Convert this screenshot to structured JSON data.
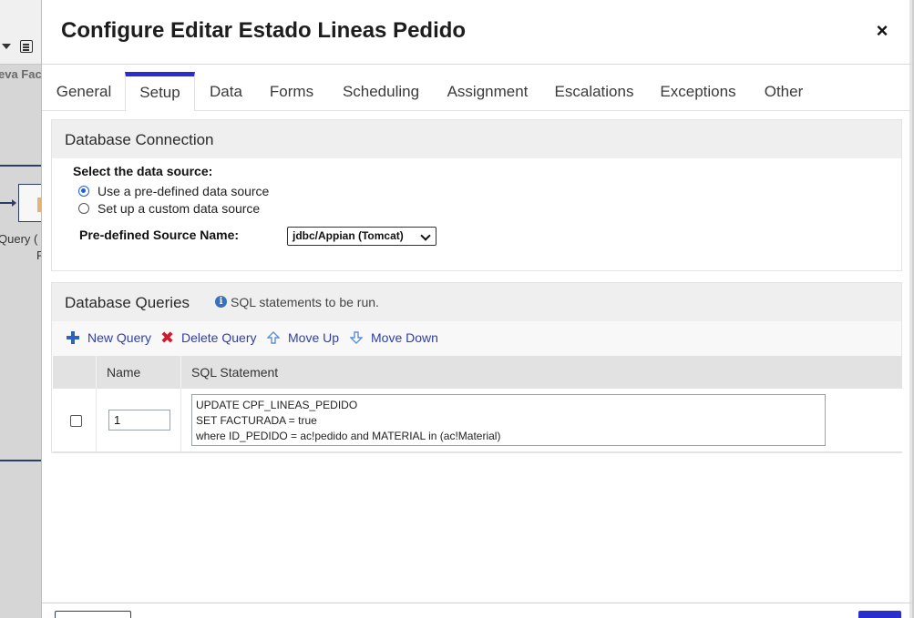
{
  "background_app": {
    "visible_text": "eva Fac",
    "node_label_line1": "Query  (",
    "node_label_line2": "F"
  },
  "dialog": {
    "title": "Configure Editar Estado Lineas Pedido",
    "close_icon": "×"
  },
  "tabs": [
    {
      "label": "General",
      "active": false
    },
    {
      "label": "Setup",
      "active": true
    },
    {
      "label": "Data",
      "active": false
    },
    {
      "label": "Forms",
      "active": false
    },
    {
      "label": "Scheduling",
      "active": false
    },
    {
      "label": "Assignment",
      "active": false
    },
    {
      "label": "Escalations",
      "active": false
    },
    {
      "label": "Exceptions",
      "active": false
    },
    {
      "label": "Other",
      "active": false
    }
  ],
  "database_connection": {
    "title": "Database Connection",
    "source_label": "Select the data source:",
    "options": [
      {
        "label": "Use a pre-defined data source",
        "selected": true
      },
      {
        "label": "Set up a custom data source",
        "selected": false
      }
    ],
    "predefined_label": "Pre-defined Source Name:",
    "predefined_value": "jdbc/Appian (Tomcat)"
  },
  "database_queries": {
    "title": "Database Queries",
    "info_text": "SQL statements to be run.",
    "toolbar": {
      "new_query": "New Query",
      "delete_query": "Delete Query",
      "move_up": "Move Up",
      "move_down": "Move Down"
    },
    "columns": {
      "name": "Name",
      "sql": "SQL Statement"
    },
    "rows": [
      {
        "checked": false,
        "name": "1",
        "sql": "UPDATE CPF_LINEAS_PEDIDO\nSET FACTURADA = true\nwhere ID_PEDIDO = ac!pedido and MATERIAL in (ac!Material)"
      }
    ]
  },
  "colors": {
    "accent": "#2b2ecf",
    "link": "#2f3fa8",
    "delete": "#d3192c",
    "info": "#3b6fb6"
  }
}
